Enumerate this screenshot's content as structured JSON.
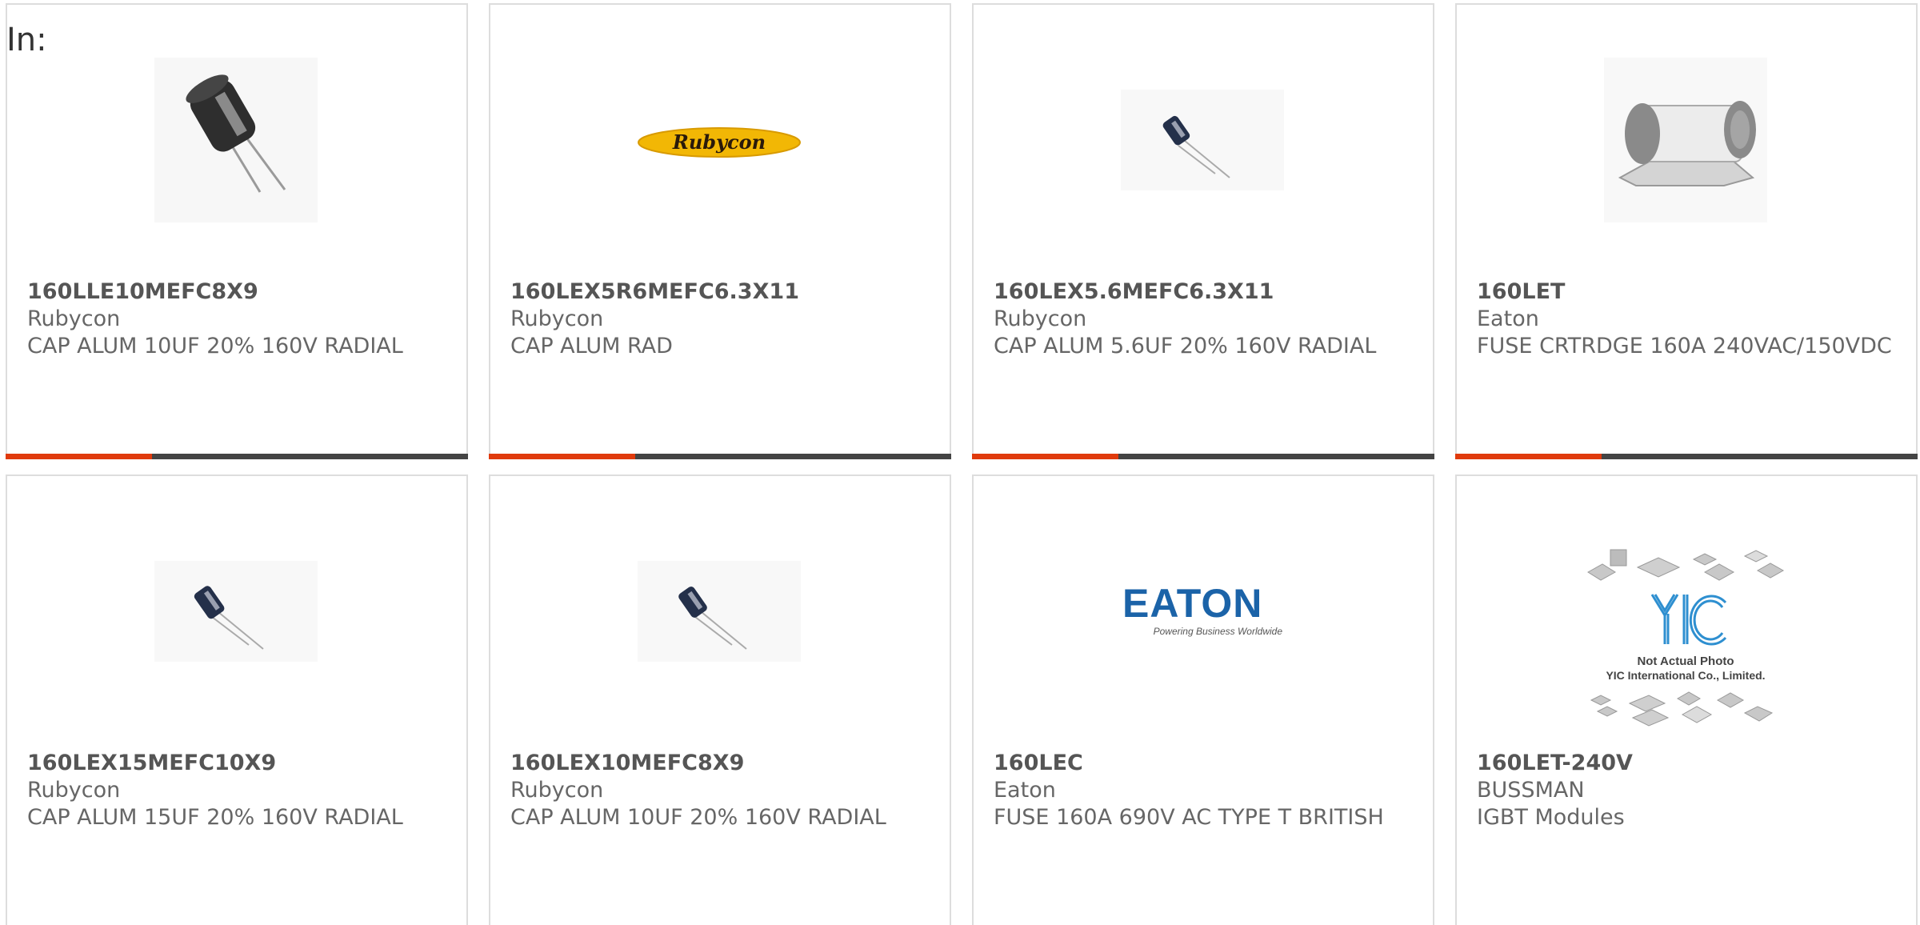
{
  "header": {
    "label": "In:"
  },
  "products": [
    {
      "part": "160LLE10MEFC8X9",
      "maker": "Rubycon",
      "desc": "CAP ALUM 10UF 20% 160V RADIAL",
      "image": "capacitor-large-image"
    },
    {
      "part": "160LEX5R6MEFC6.3X11",
      "maker": "Rubycon",
      "desc": "CAP ALUM RAD",
      "image": "rubycon-logo",
      "logo_text": "Rubycon"
    },
    {
      "part": "160LEX5.6MEFC6.3X11",
      "maker": "Rubycon",
      "desc": "CAP ALUM 5.6UF 20% 160V RADIAL",
      "image": "capacitor-small-image"
    },
    {
      "part": "160LET",
      "maker": "Eaton",
      "desc": "FUSE CRTRDGE 160A 240VAC/150VDC",
      "image": "fuse-cartridge-image"
    },
    {
      "part": "160LEX15MEFC10X9",
      "maker": "Rubycon",
      "desc": "CAP ALUM 15UF 20% 160V RADIAL",
      "image": "capacitor-small-image"
    },
    {
      "part": "160LEX10MEFC8X9",
      "maker": "Rubycon",
      "desc": "CAP ALUM 10UF 20% 160V RADIAL",
      "image": "capacitor-small-image"
    },
    {
      "part": "160LEC",
      "maker": "Eaton",
      "desc": "FUSE 160A 690V AC TYPE T BRITISH",
      "image": "eaton-logo",
      "logo_text": "EATON",
      "logo_tagline": "Powering Business Worldwide"
    },
    {
      "part": "160LET-240V",
      "maker": "BUSSMAN",
      "desc": "IGBT Modules",
      "image": "not-actual-photo-image",
      "logo_text": "YIC",
      "note_line1": "Not Actual Photo",
      "note_line2": "YIC International Co., Limited."
    }
  ],
  "colors": {
    "accent_bar": "#e03a0c",
    "bar": "#444444",
    "border": "#dddddd",
    "rubycon_yellow": "#f2b705",
    "eaton_blue": "#1b63a8",
    "yic_blue": "#2e8fd0"
  }
}
